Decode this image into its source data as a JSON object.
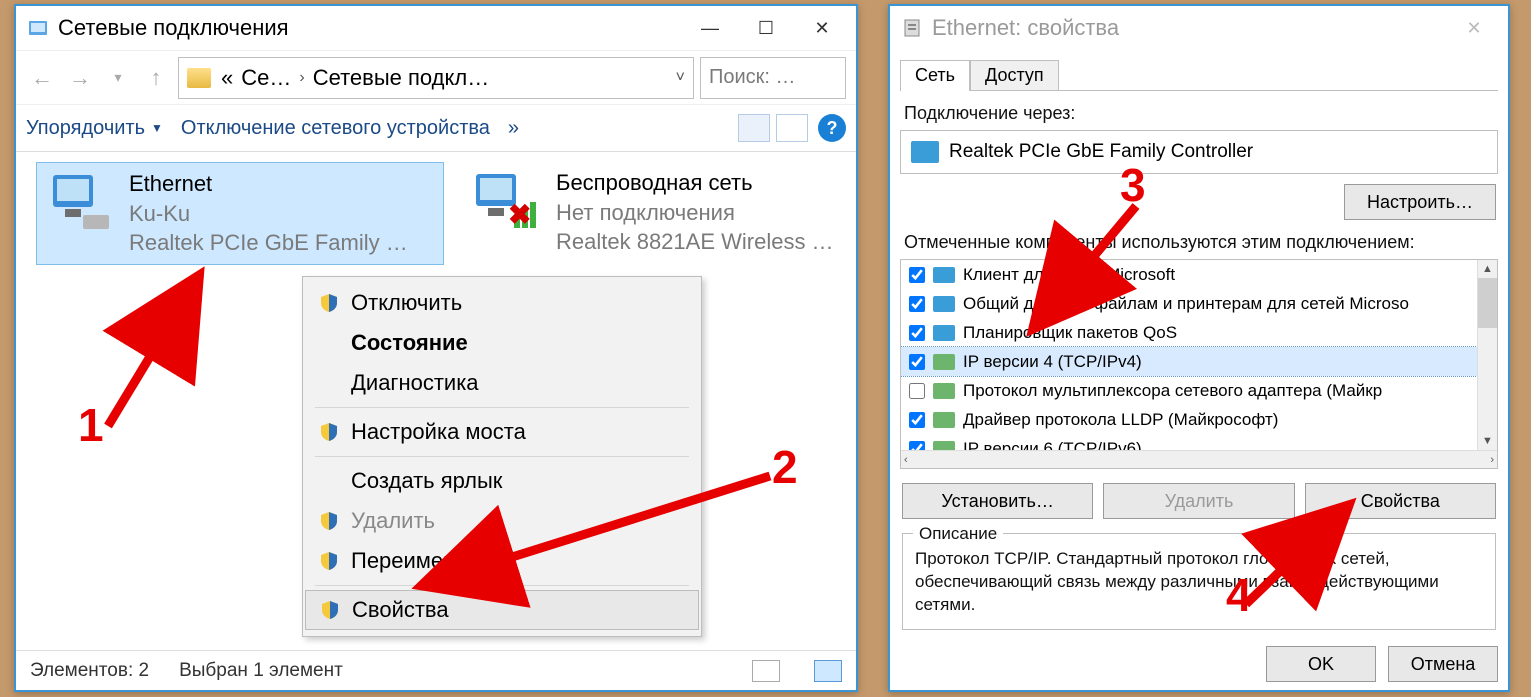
{
  "w1": {
    "title": "Сетевые подключения",
    "breadcrumb": {
      "seg1": "Се…",
      "seg2": "Сетевые подкл…"
    },
    "search_placeholder": "Поиск: …",
    "toolbar": {
      "organize": "Упорядочить",
      "disable": "Отключение сетевого устройства",
      "chev": "»"
    },
    "items": [
      {
        "name": "Ethernet",
        "line2": "Ku-Ku",
        "line3": "Realtek PCIe GbE Family …"
      },
      {
        "name": "Беспроводная сеть",
        "line2": "Нет подключения",
        "line3": "Realtek 8821AE Wireless …"
      }
    ],
    "ctx": {
      "disable": "Отключить",
      "status": "Состояние",
      "diag": "Диагностика",
      "bridge": "Настройка моста",
      "shortcut": "Создать ярлык",
      "delete": "Удалить",
      "rename": "Переименовать",
      "props": "Свойства"
    },
    "status": {
      "count": "Элементов: 2",
      "selected": "Выбран 1 элемент"
    }
  },
  "w2": {
    "title": "Ethernet: свойства",
    "tabs": {
      "net": "Сеть",
      "access": "Доступ"
    },
    "connect_via": "Подключение через:",
    "adapter": "Realtek PCIe GbE Family Controller",
    "configure": "Настроить…",
    "components_label": "Отмеченные компоненты используются этим подключением:",
    "components": [
      {
        "checked": true,
        "icon": "mon",
        "label": "Клиент для сетей Microsoft"
      },
      {
        "checked": true,
        "icon": "mon",
        "label": "Общий доступ к файлам и принтерам для сетей Microso"
      },
      {
        "checked": true,
        "icon": "mon",
        "label": "Планировщик пакетов QoS"
      },
      {
        "checked": true,
        "icon": "nic",
        "label": "IP версии 4 (TCP/IPv4)",
        "sel": true
      },
      {
        "checked": false,
        "icon": "nic",
        "label": "Протокол мультиплексора сетевого адаптера (Майкр"
      },
      {
        "checked": true,
        "icon": "nic",
        "label": "Драйвер протокола LLDP (Майкрософт)"
      },
      {
        "checked": true,
        "icon": "nic",
        "label": "IP версии 6 (TCP/IPv6)"
      }
    ],
    "install": "Установить…",
    "remove": "Удалить",
    "properties": "Свойства",
    "desc_legend": "Описание",
    "desc": "Протокол TCP/IP. Стандартный протокол глобальных сетей, обеспечивающий связь между различными взаимодействующими сетями.",
    "ok": "OK",
    "cancel": "Отмена"
  },
  "markers": {
    "m1": "1",
    "m2": "2",
    "m3": "3",
    "m4": "4"
  }
}
